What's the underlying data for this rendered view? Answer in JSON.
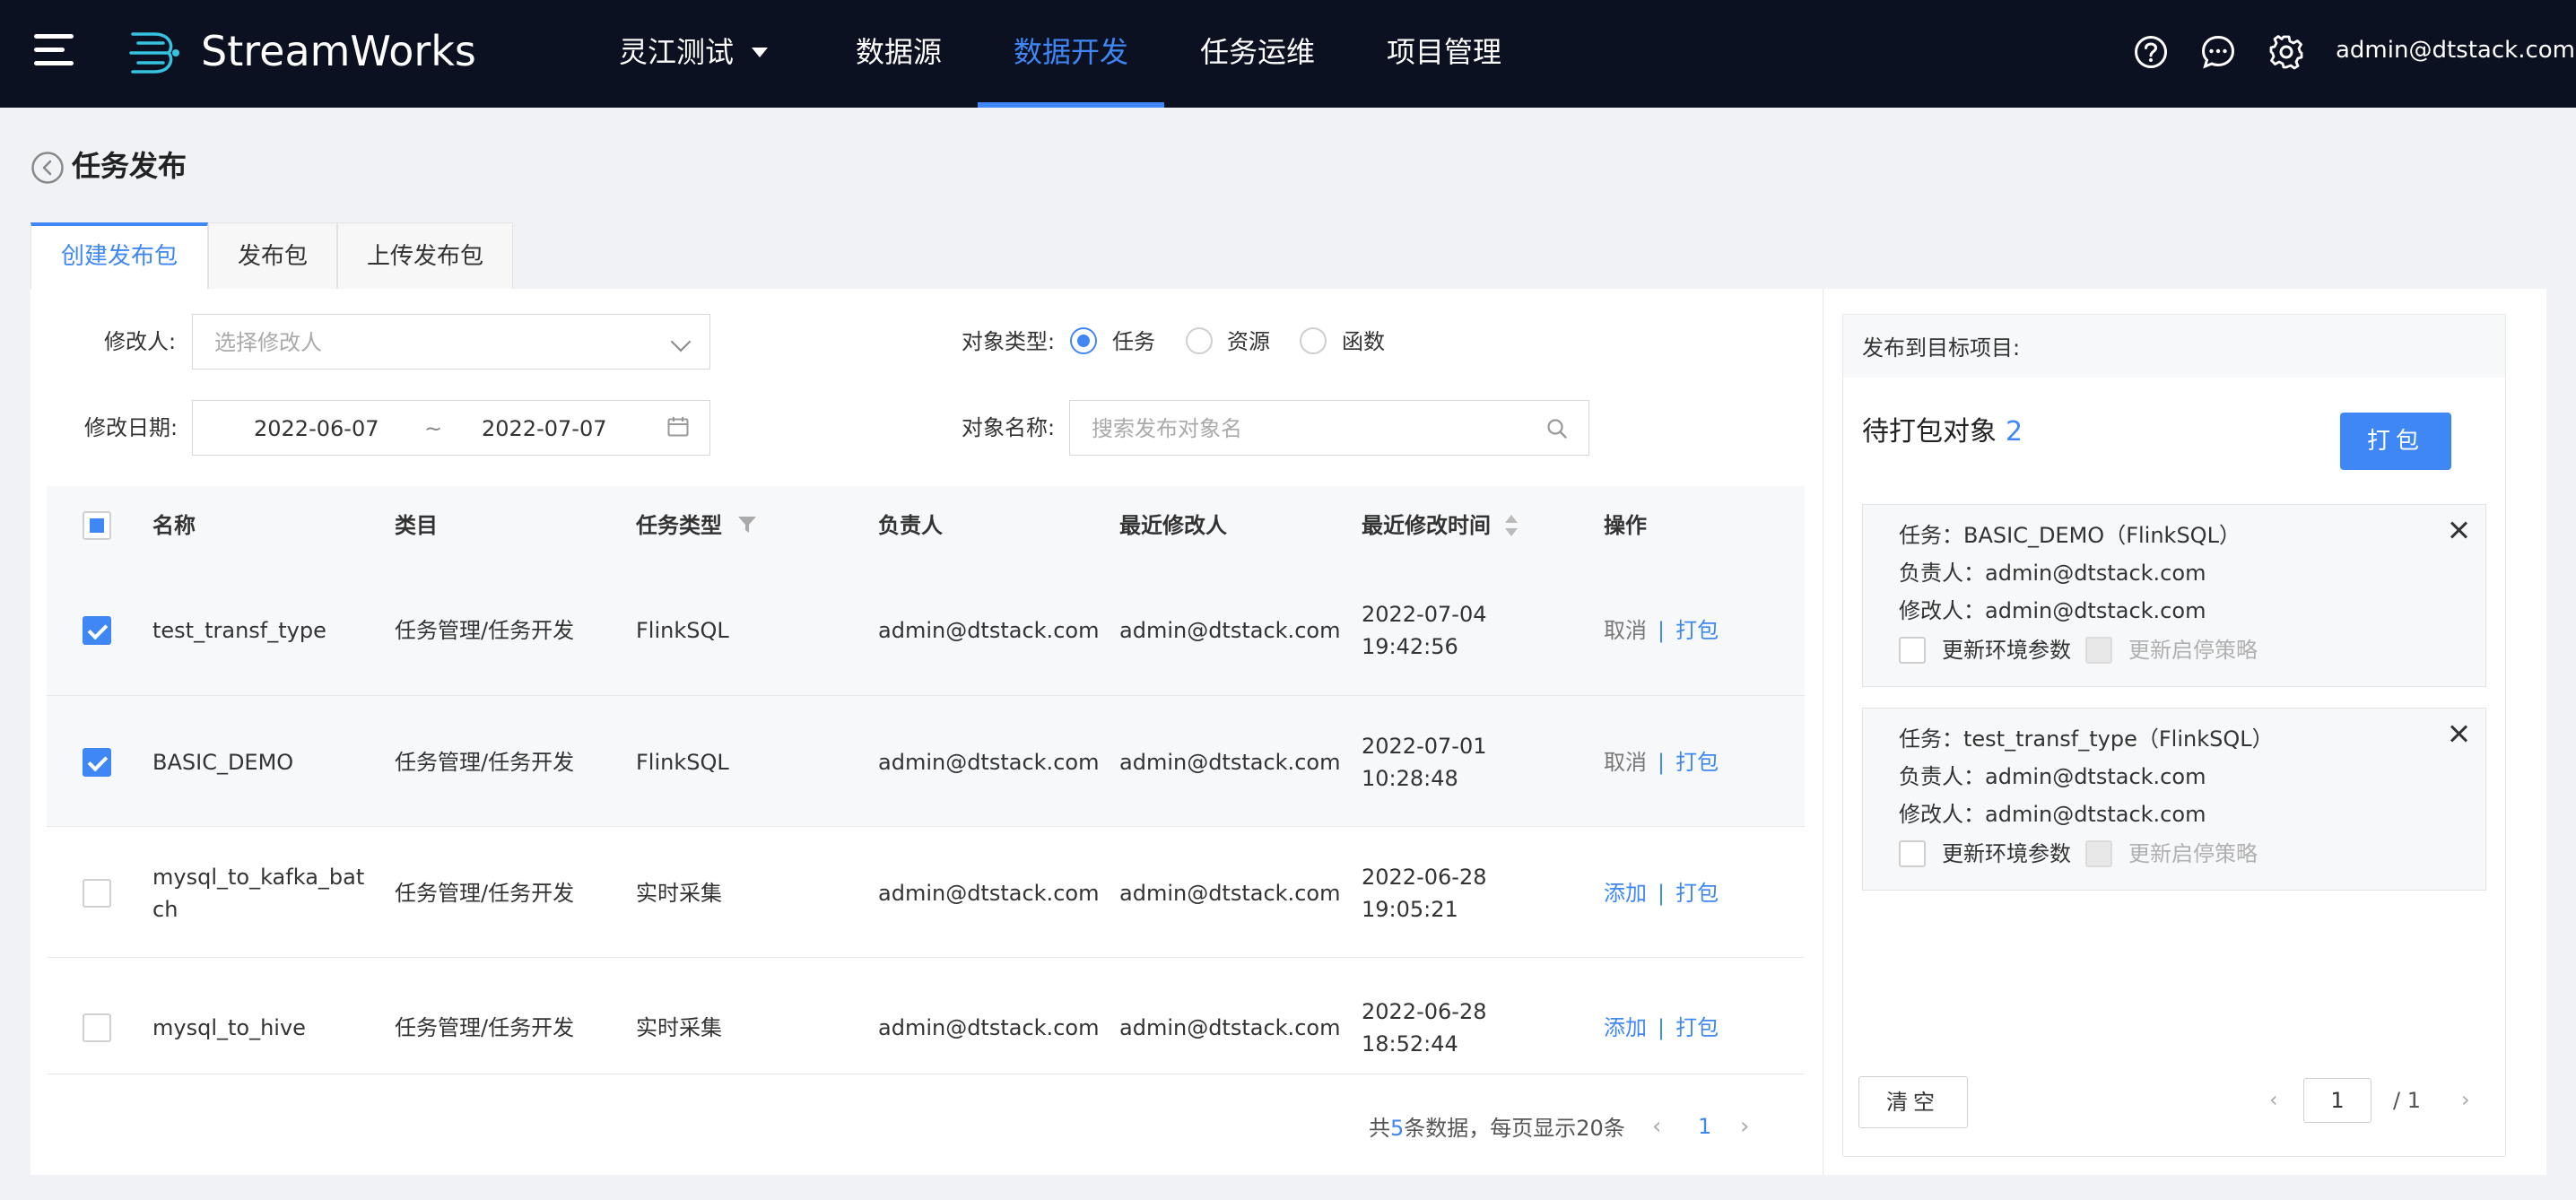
{
  "app": {
    "brand": "StreamWorks",
    "project": "灵江测试"
  },
  "nav": {
    "items": [
      {
        "label": "数据源",
        "active": false
      },
      {
        "label": "数据开发",
        "active": true
      },
      {
        "label": "任务运维",
        "active": false
      },
      {
        "label": "项目管理",
        "active": false
      }
    ],
    "user_email": "admin@dtstack.com",
    "icons": [
      "help-icon",
      "message-icon",
      "gear-icon"
    ]
  },
  "page": {
    "title": "任务发布"
  },
  "tabs": [
    "创建发布包",
    "发布包",
    "上传发布包"
  ],
  "filters": {
    "modifier_label": "修改人:",
    "modifier_placeholder": "选择修改人",
    "date_label": "修改日期:",
    "date_start": "2022-06-07",
    "date_sep": "~",
    "date_end": "2022-07-07",
    "object_type_label": "对象类型:",
    "object_types": [
      "任务",
      "资源",
      "函数"
    ],
    "object_type_selected": "任务",
    "object_name_label": "对象名称:",
    "object_name_placeholder": "搜索发布对象名"
  },
  "table": {
    "columns": [
      "名称",
      "类目",
      "任务类型",
      "负责人",
      "最近修改人",
      "最近修改时间",
      "操作"
    ],
    "rows": [
      {
        "checked": true,
        "name": "test_transf_type",
        "category": "任务管理/任务开发",
        "type": "FlinkSQL",
        "owner": "admin@dtstack.com",
        "modifier": "admin@dtstack.com",
        "date": "2022-07-04",
        "time": "19:42:56",
        "action1": "取消",
        "action2": "打包",
        "sep": "|"
      },
      {
        "checked": true,
        "name": "BASIC_DEMO",
        "category": "任务管理/任务开发",
        "type": "FlinkSQL",
        "owner": "admin@dtstack.com",
        "modifier": "admin@dtstack.com",
        "date": "2022-07-01",
        "time": "10:28:48",
        "action1": "取消",
        "action2": "打包",
        "sep": "|"
      },
      {
        "checked": false,
        "name": "mysql_to_kafka_bat",
        "name2": "ch",
        "category": "任务管理/任务开发",
        "type": "实时采集",
        "owner": "admin@dtstack.com",
        "modifier": "admin@dtstack.com",
        "date": "2022-06-28",
        "time": "19:05:21",
        "action1": "添加",
        "action2": "打包",
        "sep": "|"
      },
      {
        "checked": false,
        "name": "mysql_to_hive",
        "category": "任务管理/任务开发",
        "type": "实时采集",
        "owner": "admin@dtstack.com",
        "modifier": "admin@dtstack.com",
        "date": "2022-06-28",
        "time": "18:52:44",
        "action1": "添加",
        "action2": "打包",
        "sep": "|"
      }
    ]
  },
  "pagination": {
    "prefix": "共",
    "total": "5",
    "suffix": "条数据，每页显示20条",
    "current": "1"
  },
  "release": {
    "target_label": "发布到目标项目:",
    "pending_label": "待打包对象",
    "pending_count": "2",
    "pack_button": "打包",
    "cards": [
      {
        "task": "任务：BASIC_DEMO（FlinkSQL）",
        "owner": "负责人：admin@dtstack.com",
        "modifier": "修改人：admin@dtstack.com",
        "opt1": "更新环境参数",
        "opt2": "更新启停策略"
      },
      {
        "task": "任务：test_transf_type（FlinkSQL）",
        "owner": "负责人：admin@dtstack.com",
        "modifier": "修改人：admin@dtstack.com",
        "opt1": "更新环境参数",
        "opt2": "更新启停策略"
      }
    ],
    "clear_button": "清空",
    "page_current": "1",
    "page_total": "/ 1"
  }
}
